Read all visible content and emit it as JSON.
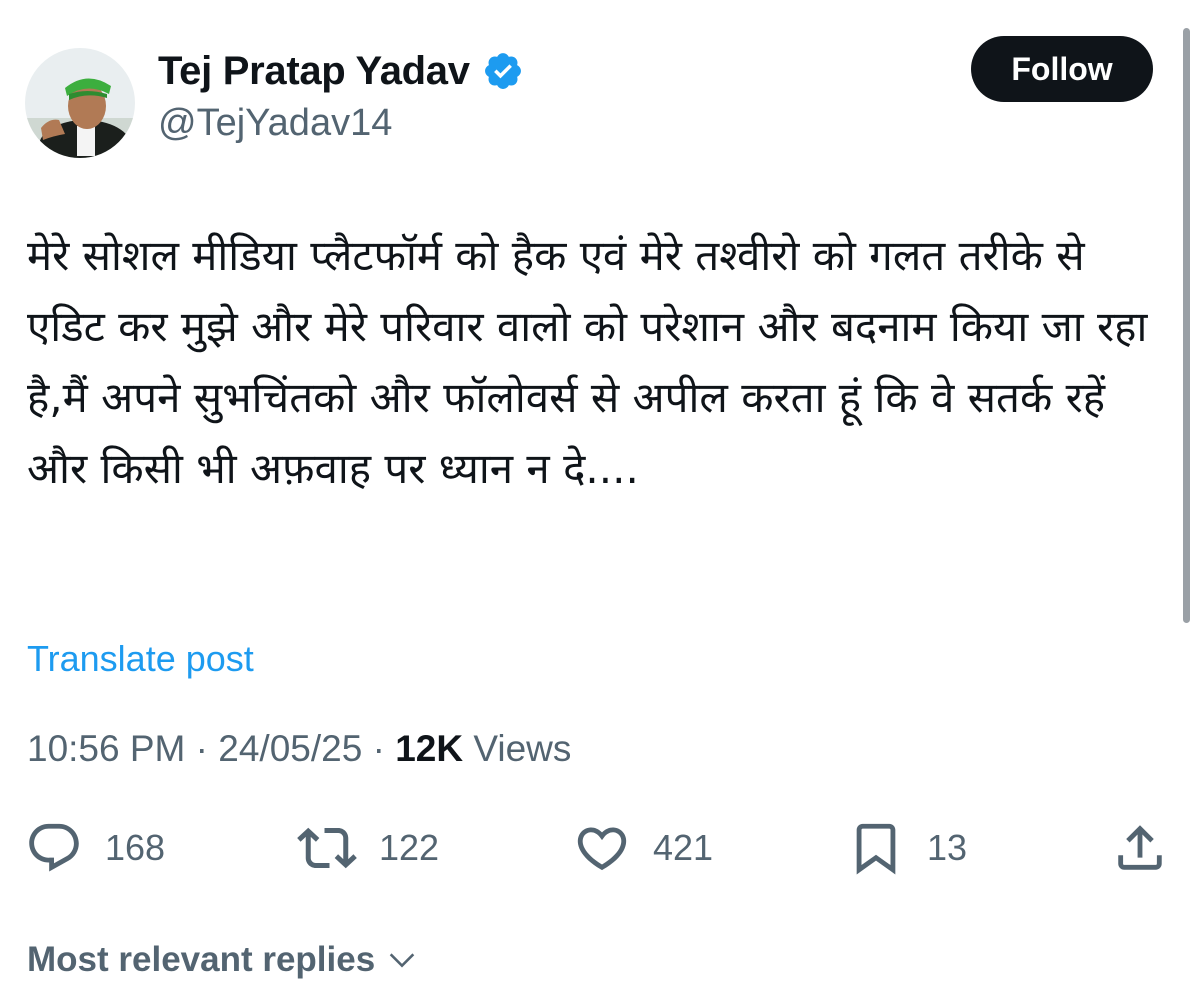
{
  "author": {
    "display_name": "Tej Pratap Yadav",
    "handle": "@TejYadav14",
    "verified": true
  },
  "follow_button": {
    "label": "Follow"
  },
  "post": {
    "text": "मेरे सोशल मीडिया प्लैटफॉर्म को हैक एवं मेरे तश्वीरो को गलत तरीके से एडिट कर मुझे और मेरे परिवार वालो को परेशान और बदनाम किया जा रहा है,मैं अपने सुभचिंतको और फॉलोवर्स से अपील करता हूं कि वे सतर्क रहें और किसी भी अफ़वाह पर ध्यान न दे....",
    "translate_label": "Translate post",
    "time": "10:56 PM",
    "date": "24/05/25",
    "separator": "·",
    "views_count": "12K",
    "views_label": "Views"
  },
  "actions": {
    "replies": {
      "icon": "reply-icon",
      "count": "168"
    },
    "reposts": {
      "icon": "repost-icon",
      "count": "122"
    },
    "likes": {
      "icon": "heart-icon",
      "count": "421"
    },
    "bookmarks": {
      "icon": "bookmark-icon",
      "count": "13"
    },
    "share": {
      "icon": "share-icon"
    }
  },
  "replies_section": {
    "label": "Most relevant replies",
    "icon": "chevron-down-icon"
  },
  "colors": {
    "text_primary": "#0f1419",
    "text_secondary": "#536471",
    "link": "#1d9bf0",
    "verified_badge": "#1d9bf0",
    "follow_bg": "#0f1419"
  }
}
